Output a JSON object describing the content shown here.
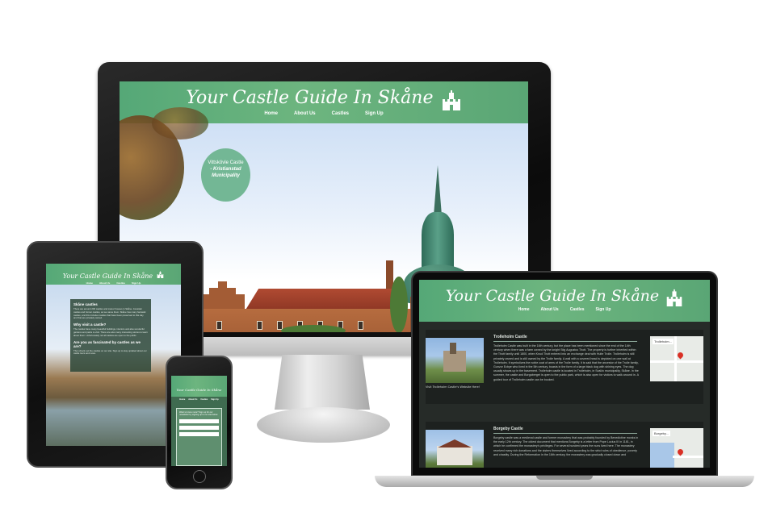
{
  "site": {
    "title": "Your Castle Guide In Skåne",
    "nav": [
      "Home",
      "About Us",
      "Castles",
      "Sign Up"
    ]
  },
  "colors": {
    "header_green": "#5aa675",
    "bubble_green": "#73b795",
    "dark_bg": "#262b28"
  },
  "monitor": {
    "bubble": {
      "title": "Vittskövle Castle",
      "subtitle": "- Kristianstad Municipality"
    }
  },
  "laptop": {
    "cards": [
      {
        "title": "Trolleholm Castle",
        "caption": "Visit Trolleholm Castle's Website Here!",
        "text": "Trolleholm Castle was built in the 16th century, but the place has been mentioned since the end of the 14th century when there was a farm owned by the knight Stig Augustus Thott. The property is further inherited within the Thott family until 1800, when Knud Thott entered into an exchange deal with Hulte Trolle. Trolleholm is still privately owned and is still owned by the Trolle family. A wall with a covered head is depicted on one wall at Trolleholm. It symbolizes the noble coat of arms of the Trolle family. It is said that the ancestor of the Trolle family, Gunvor Ecbye who lived in the 5th century, boasts in the form of a large black dog with shining eyes. The dog usually shows up in the basement. Trolleholm castle is located in Trolleholm, in Svalöv municipality, Skåne. In the summer, the castle and Borgaberget is open to the public park, which is also open for visitors to walk around in. A guided tour of Trolleholm castle can be booked.",
        "map_label": "Trolleholm..."
      },
      {
        "title": "Borgeby Castle",
        "text": "Borgeby castle was a medieval castle and former monastery that was probably founded by Benedictine monks in the early 12th century. The oldest document that mentions Borgeby is a letter from Pope Lucius III in 1181, in which he confirmed the monastery's privileges. For several hundred years the nuns lived here. The monastery received many rich donations and the sisters themselves lived according to the strict rules of obedience, poverty and chastity. During the Reformation in the 16th century, the monastery was gradually closed down and",
        "map_label": "Borgeby..."
      }
    ]
  },
  "tablet": {
    "sections": [
      {
        "heading": "Skåne castles",
        "text": "There are around 200 castles and manor houses in Skåne. Consider castles and former castles, as we name them. Skåne has many fantastic castles, and this includes castles that have been preserved to this day and that are privately owned."
      },
      {
        "heading": "Why visit a castle?",
        "text": "The castles have many beautiful buildings, interiors and also wonderful gardens and parks to visit. There are also many interesting stories to learn about them. Unfortunately not all castles are open to the public."
      },
      {
        "heading": "Are you as fascinated by castles as we are?",
        "text": "Then check out the castles on our site. Sign up to stay updated about our castle tours and news."
      }
    ]
  },
  "phone": {
    "form_intro": "Want to know more? Sign up for our newsletter by signing up to our site below"
  }
}
